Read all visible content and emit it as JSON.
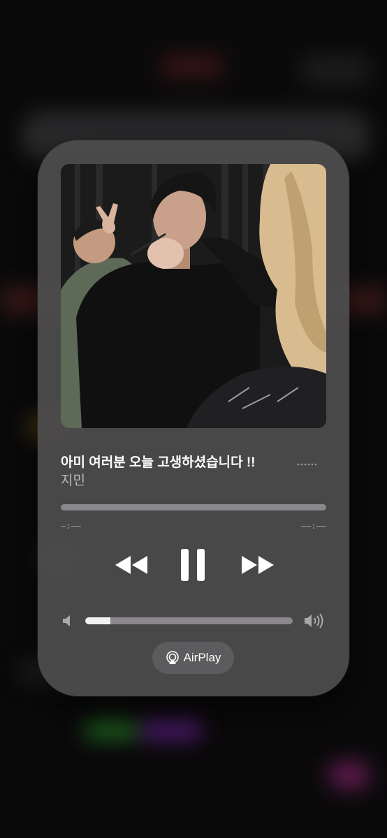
{
  "now_playing": {
    "title": "아미 여러분 오늘 고생하셨습니다 !!",
    "artist": "지민",
    "more_icon": "ellipsis-icon",
    "progress": 0.0,
    "elapsed_time": "–:––",
    "remaining_time": "––:––"
  },
  "controls": {
    "rewind_icon": "rewind-icon",
    "pause_icon": "pause-icon",
    "forward_icon": "fast-forward-icon"
  },
  "volume": {
    "level": 0.12,
    "low_icon": "speaker-low-icon",
    "high_icon": "speaker-high-icon"
  },
  "airplay": {
    "label": "AirPlay",
    "icon": "airplay-icon"
  },
  "colors": {
    "card_background": "#4e4c4e",
    "track": "#8a888b",
    "fill": "#f2f2f2",
    "text_primary": "#ffffff",
    "text_secondary": "#bdbcbe"
  }
}
